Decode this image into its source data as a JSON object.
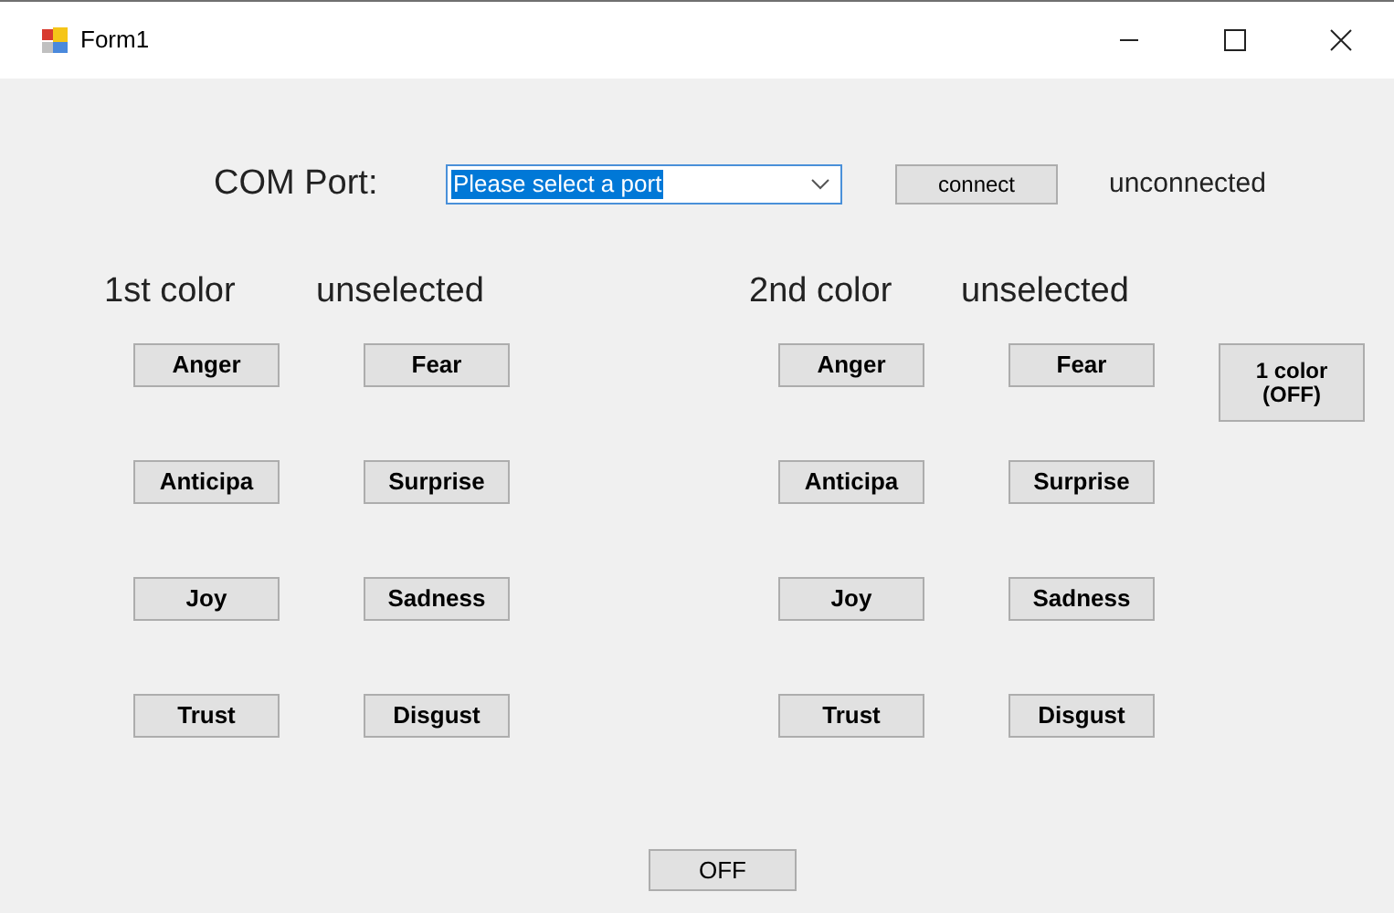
{
  "window": {
    "title": "Form1"
  },
  "port": {
    "label": "COM Port:",
    "value": "Please select a port",
    "connect": "connect",
    "status": "unconnected"
  },
  "groups": [
    {
      "title": "1st color",
      "status": "unselected",
      "buttons": [
        "Anger",
        "Fear",
        "Anticipa",
        "Surprise",
        "Joy",
        "Sadness",
        "Trust",
        "Disgust"
      ]
    },
    {
      "title": "2nd color",
      "status": "unselected",
      "buttons": [
        "Anger",
        "Fear",
        "Anticipa",
        "Surprise",
        "Joy",
        "Sadness",
        "Trust",
        "Disgust"
      ]
    }
  ],
  "mode_button": [
    "1 color",
    "(OFF)"
  ],
  "off_button": "OFF"
}
